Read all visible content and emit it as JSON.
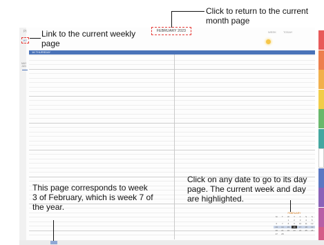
{
  "planner": {
    "brand": "Pl",
    "month_label": "FEBRUARY 2023",
    "week_link_label": "W7",
    "top_right_left": "WEEK",
    "top_right_right": "TODAY",
    "day_label": "16  THURSDAY",
    "side_text": [
      "MAY",
      "JUN"
    ],
    "tabs": [
      {
        "color": "#e85a5a"
      },
      {
        "color": "#ed7f4d"
      },
      {
        "color": "#f2b04b"
      },
      {
        "color": "#f1cd48"
      },
      {
        "color": "#6ab86b"
      },
      {
        "color": "#44a7a0"
      },
      {
        "color": "#ffffff"
      },
      {
        "color": "#5b78c3"
      },
      {
        "color": "#8a62b8"
      },
      {
        "color": "#b75fa6"
      },
      {
        "color": "#d45d88"
      }
    ]
  },
  "mini_calendar": {
    "title": "FEBRUARY",
    "weekday_headers": [
      "M",
      "T",
      "W",
      "T",
      "F",
      "S",
      "S"
    ],
    "rows": [
      [
        "",
        "",
        "1",
        "2",
        "3",
        "4",
        "5"
      ],
      [
        "6",
        "7",
        "8",
        "9",
        "10",
        "11",
        "12"
      ],
      [
        "13",
        "14",
        "15",
        "16",
        "17",
        "18",
        "19"
      ],
      [
        "20",
        "21",
        "22",
        "23",
        "24",
        "25",
        "26"
      ],
      [
        "27",
        "28",
        "",
        "",
        "",
        "",
        ""
      ]
    ],
    "highlight_row": 2,
    "highlight_day": "16"
  },
  "week_strip": {
    "active_index": 3
  },
  "annotations": {
    "weekly_link": "Link to the current weekly page",
    "month_link": "Click to return to the current month page",
    "day_page": "Click on any date to go to its day page. The current week and day are highlighted.",
    "week_number": "This page corresponds to week 3 of February, which is week 7 of the year."
  }
}
